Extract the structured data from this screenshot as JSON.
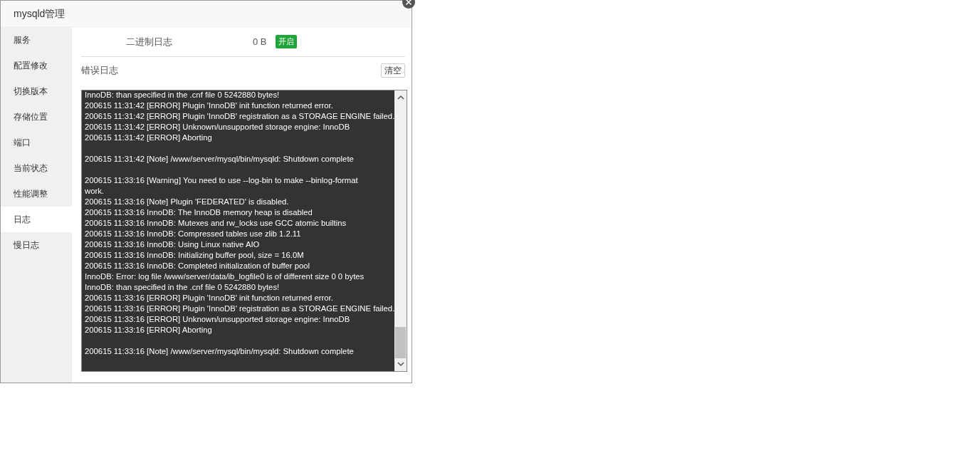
{
  "window": {
    "title": "mysqld管理"
  },
  "sidebar": {
    "items": [
      {
        "label": "服务",
        "selected": false
      },
      {
        "label": "配置修改",
        "selected": false
      },
      {
        "label": "切换版本",
        "selected": false
      },
      {
        "label": "存储位置",
        "selected": false
      },
      {
        "label": "端口",
        "selected": false
      },
      {
        "label": "当前状态",
        "selected": false
      },
      {
        "label": "性能调整",
        "selected": false
      },
      {
        "label": "日志",
        "selected": true
      },
      {
        "label": "慢日志",
        "selected": false
      }
    ]
  },
  "binlog": {
    "label": "二进制日志",
    "size": "0 B",
    "status": "开启",
    "on": true
  },
  "error_log": {
    "title": "错误日志",
    "clear_button": "清空",
    "blocks": [
      [
        "InnoDB: than specified in the .cnf file 0 5242880 bytes!",
        "200615 11:31:42 [ERROR] Plugin 'InnoDB' init function returned error.",
        "200615 11:31:42 [ERROR] Plugin 'InnoDB' registration as a STORAGE ENGINE failed.",
        "200615 11:31:42 [ERROR] Unknown/unsupported storage engine: InnoDB",
        "200615 11:31:42 [ERROR] Aborting"
      ],
      [
        "200615 11:31:42 [Note] /www/server/mysql/bin/mysqld: Shutdown complete"
      ],
      [
        "200615 11:33:16 [Warning] You need to use --log-bin to make --binlog-format",
        "work.",
        "200615 11:33:16 [Note] Plugin 'FEDERATED' is disabled.",
        "200615 11:33:16 InnoDB: The InnoDB memory heap is disabled",
        "200615 11:33:16 InnoDB: Mutexes and rw_locks use GCC atomic builtins",
        "200615 11:33:16 InnoDB: Compressed tables use zlib 1.2.11",
        "200615 11:33:16 InnoDB: Using Linux native AIO",
        "200615 11:33:16 InnoDB: Initializing buffer pool, size = 16.0M",
        "200615 11:33:16 InnoDB: Completed initialization of buffer pool",
        "InnoDB: Error: log file /www/server/data/ib_logfile0 is of different size 0 0 bytes",
        "InnoDB: than specified in the .cnf file 0 5242880 bytes!",
        "200615 11:33:16 [ERROR] Plugin 'InnoDB' init function returned error.",
        "200615 11:33:16 [ERROR] Plugin 'InnoDB' registration as a STORAGE ENGINE failed.",
        "200615 11:33:16 [ERROR] Unknown/unsupported storage engine: InnoDB",
        "200615 11:33:16 [ERROR] Aborting"
      ],
      [
        "200615 11:33:16 [Note] /www/server/mysql/bin/mysqld: Shutdown complete"
      ]
    ]
  }
}
